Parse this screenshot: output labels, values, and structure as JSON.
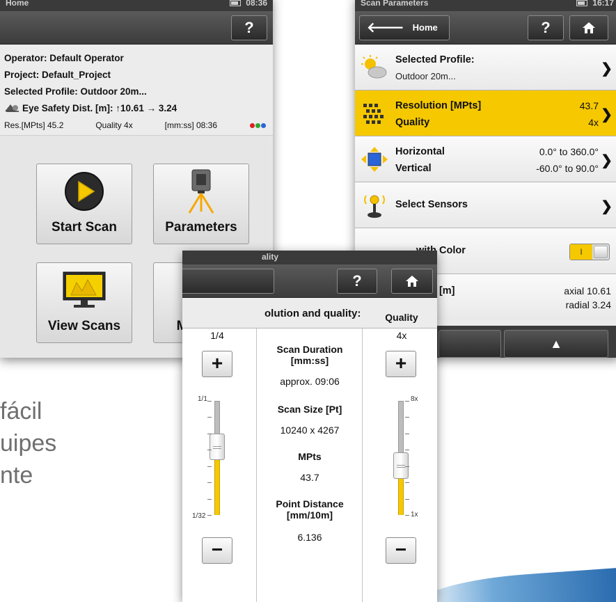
{
  "background": {
    "lines": [
      "fácil",
      "uipes",
      "nte"
    ]
  },
  "home_screen": {
    "status_title": "Home",
    "status_time": "08:36",
    "help_label": "?",
    "operator": "Operator: Default Operator",
    "project": "Project: Default_Project",
    "profile": "Selected Profile: Outdoor 20m...",
    "eye_safety": "Eye Safety Dist. [m]: ↑10.61   → 3.24",
    "res": "Res.[MPts] 45.2",
    "quality": "Quality 4x",
    "time": "[mm:ss] 08:36",
    "dot_colors": [
      "#e02020",
      "#2ea82e",
      "#2a64d8"
    ],
    "buttons": {
      "start_scan": "Start Scan",
      "parameters": "Parameters",
      "view_scans": "View Scans",
      "manage": "Manage"
    }
  },
  "params_screen": {
    "status_title": "Scan Parameters",
    "status_time": "16:17",
    "back_label": "Home",
    "help_label": "?",
    "rows": {
      "profile_label": "Selected Profile:",
      "profile_value": "Outdoor 20m...",
      "resolution_label": "Resolution [MPts]",
      "resolution_value": "43.7",
      "quality_label": "Quality",
      "quality_value": "4x",
      "horizontal_label": "Horizontal",
      "horizontal_value": "0.0° to 360.0°",
      "vertical_label": "Vertical",
      "vertical_value": "-60.0° to 90.0°",
      "sensors_label": "Select Sensors",
      "color_label": "with Color",
      "toggle_on": "I",
      "dist_label": "st. [m]",
      "axial": "axial 10.61",
      "radial": "radial 3.24"
    },
    "accent": "#f5c800"
  },
  "quality_screen": {
    "status_title": "ality",
    "help_label": "?",
    "header": "olution and quality:",
    "left": {
      "value": "1/4",
      "top_tick": "1/1",
      "bottom_tick": "1/32",
      "level_fraction": 0.6
    },
    "middle": {
      "duration_label": "Scan Duration [mm:ss]",
      "duration_value": "approx. 09:06",
      "size_label": "Scan Size [Pt]",
      "size_value": "10240 x 4267",
      "mpts_label": "MPts",
      "mpts_value": "43.7",
      "point_label": "Point Distance [mm/10m]",
      "point_value": "6.136"
    },
    "right": {
      "title": "Quality",
      "value": "4x",
      "top_tick": "8x",
      "bottom_tick": "1x",
      "level_fraction": 0.43
    },
    "plus": "+",
    "minus": "−"
  }
}
